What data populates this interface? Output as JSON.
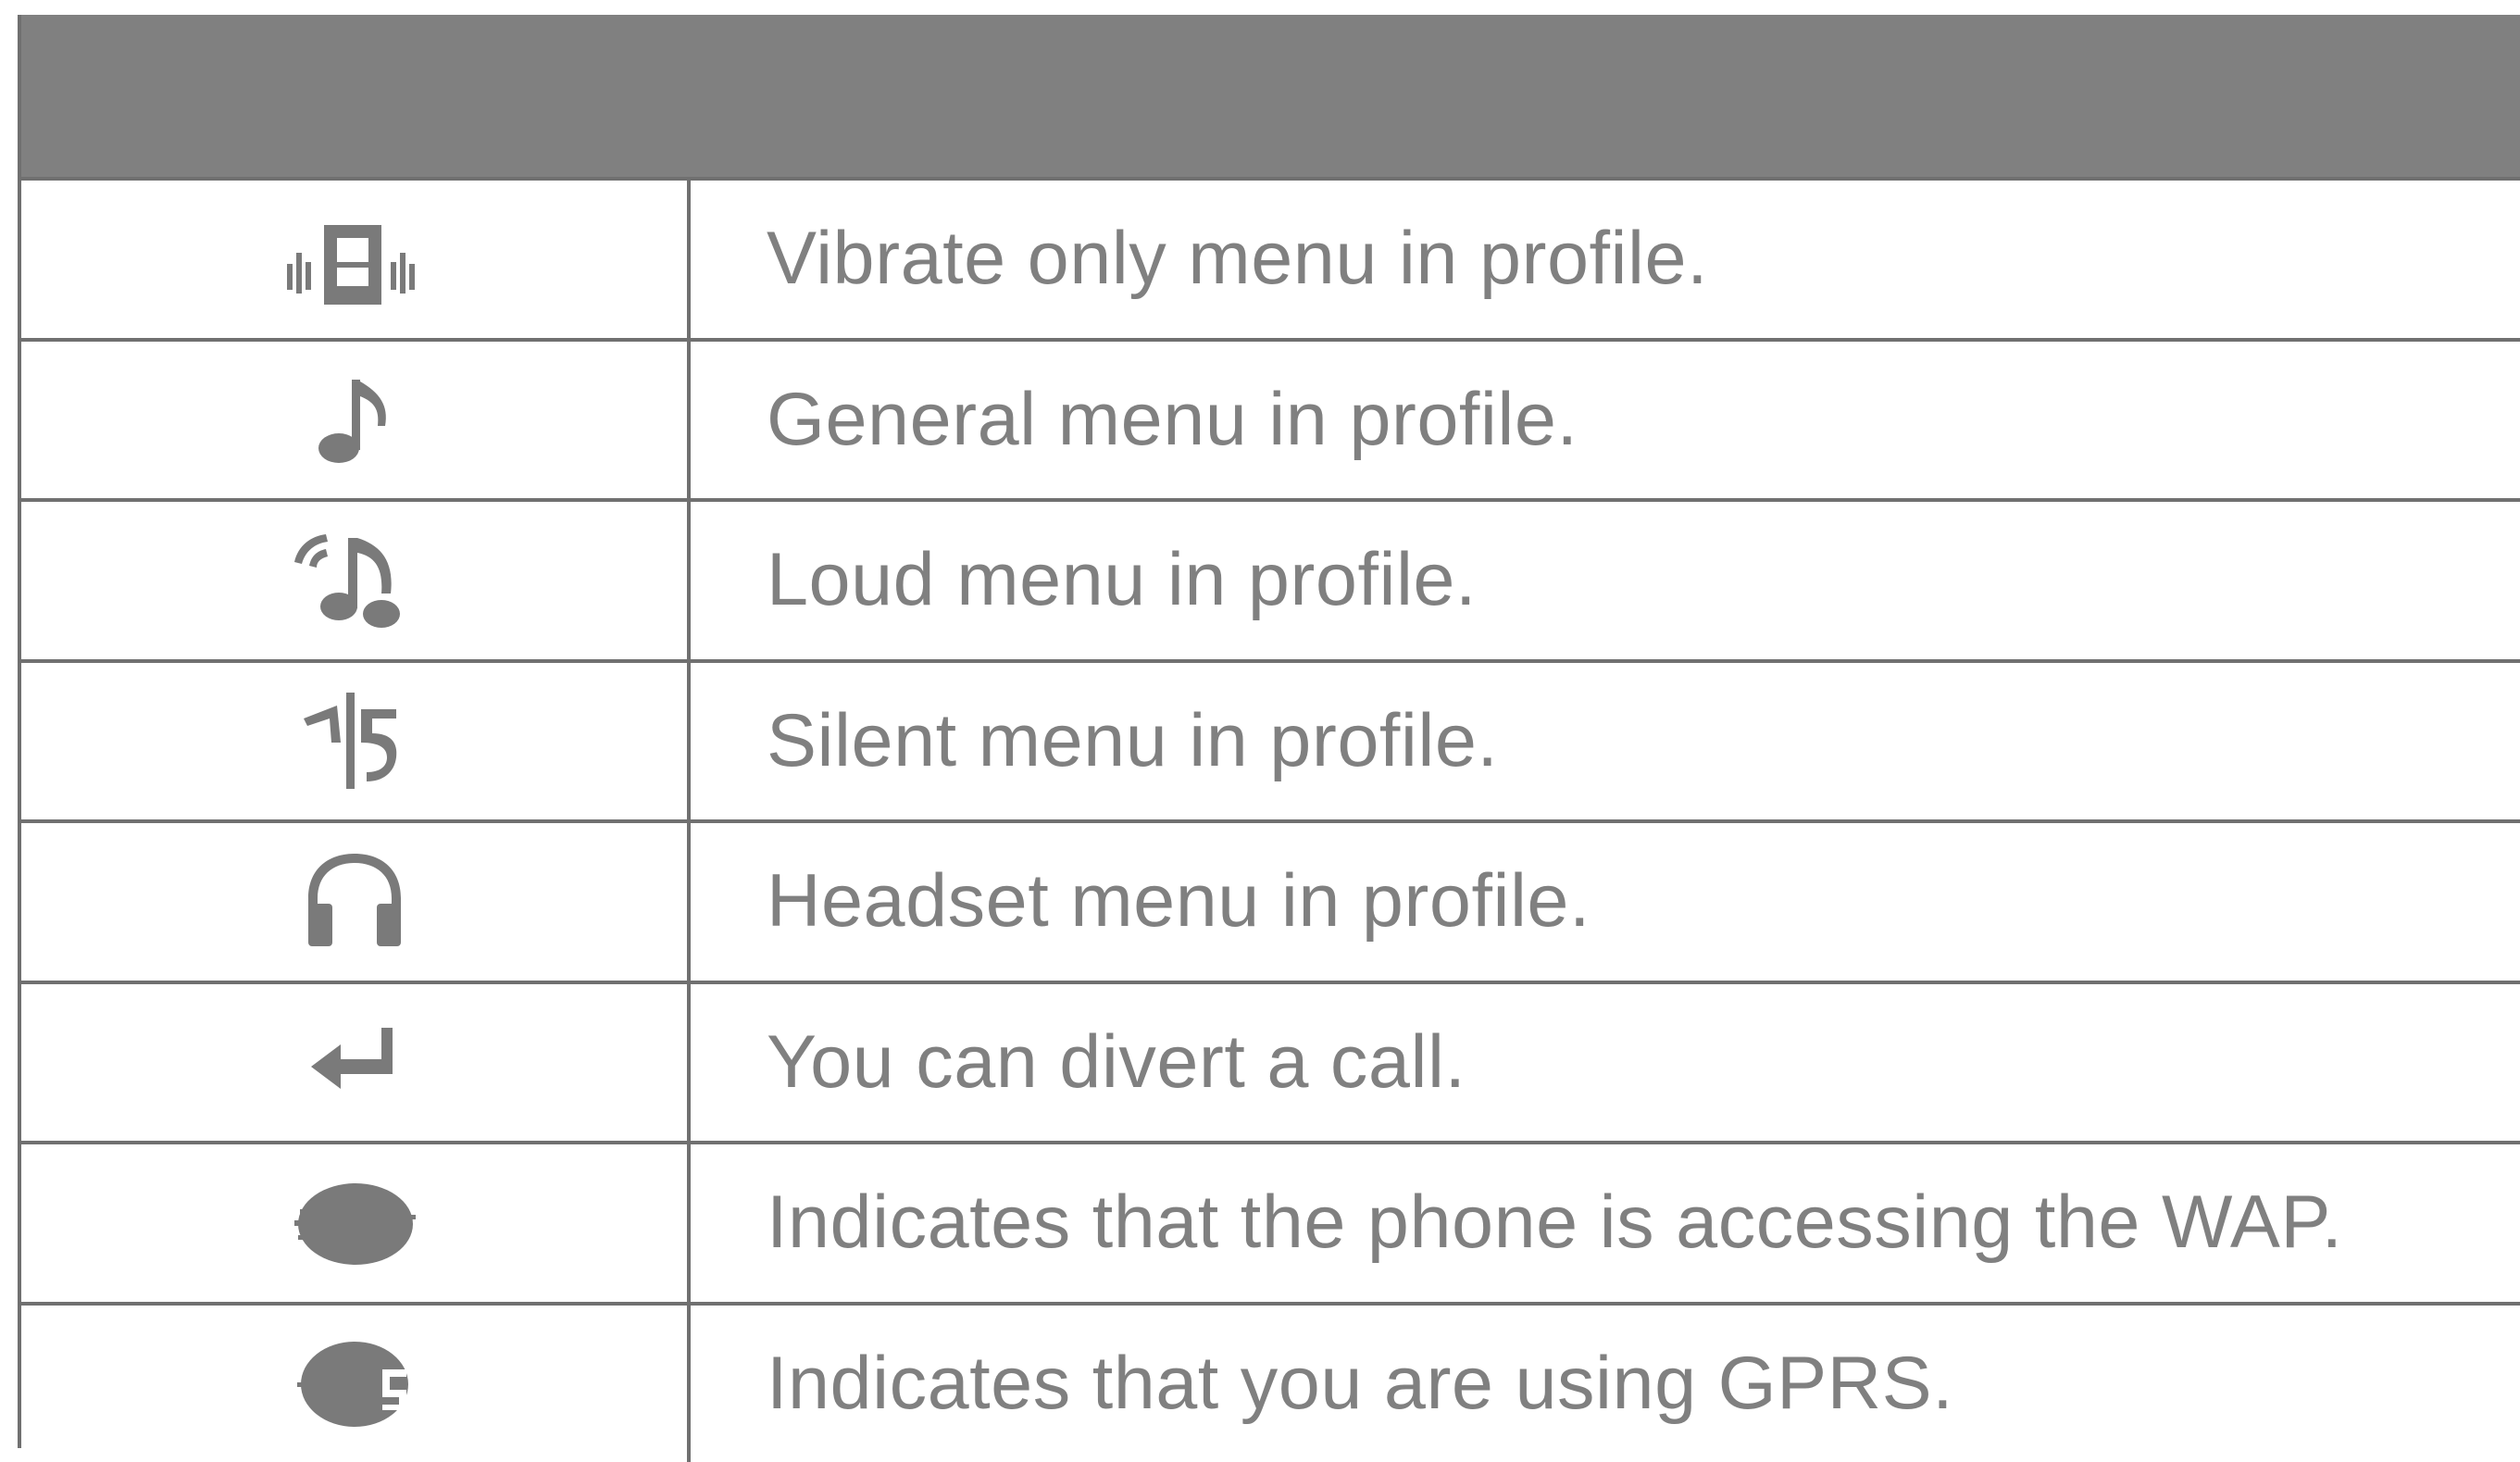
{
  "header": {
    "label": ""
  },
  "rows": [
    {
      "icon": "vibrate-icon",
      "description": "Vibrate only menu in profile."
    },
    {
      "icon": "music-note-icon",
      "description": "General menu in profile."
    },
    {
      "icon": "loud-icon",
      "description": "Loud menu in profile."
    },
    {
      "icon": "silent-icon",
      "description": "Silent menu in profile."
    },
    {
      "icon": "headset-icon",
      "description": "Headset menu in profile."
    },
    {
      "icon": "divert-call-icon",
      "description": "You can divert a call."
    },
    {
      "icon": "wap-icon",
      "description": "Indicates that the phone is accessing the WAP."
    },
    {
      "icon": "gprs-icon",
      "description": "Indicates that you are using GPRS."
    }
  ],
  "colors": {
    "header_bg": "#808080",
    "border": "#707070",
    "text": "#808080",
    "icon": "#7a7a7a"
  }
}
